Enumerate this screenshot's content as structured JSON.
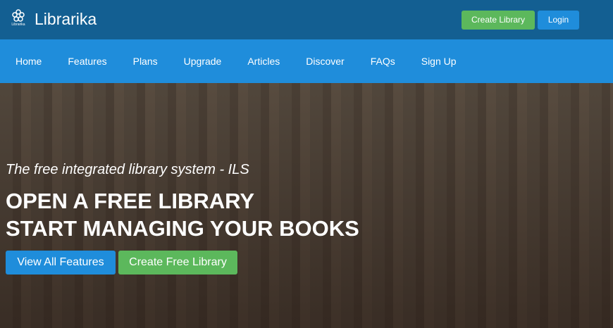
{
  "header": {
    "logo_text": "Librarika",
    "brand": "Librarika",
    "create_library": "Create Library",
    "login": "Login"
  },
  "nav": [
    "Home",
    "Features",
    "Plans",
    "Upgrade",
    "Articles",
    "Discover",
    "FAQs",
    "Sign Up"
  ],
  "hero": {
    "tagline": "The free integrated library system - ILS",
    "line1": "OPEN A FREE LIBRARY",
    "line2": "START MANAGING YOUR BOOKS",
    "view_features": "View All Features",
    "create_free": "Create Free Library"
  }
}
